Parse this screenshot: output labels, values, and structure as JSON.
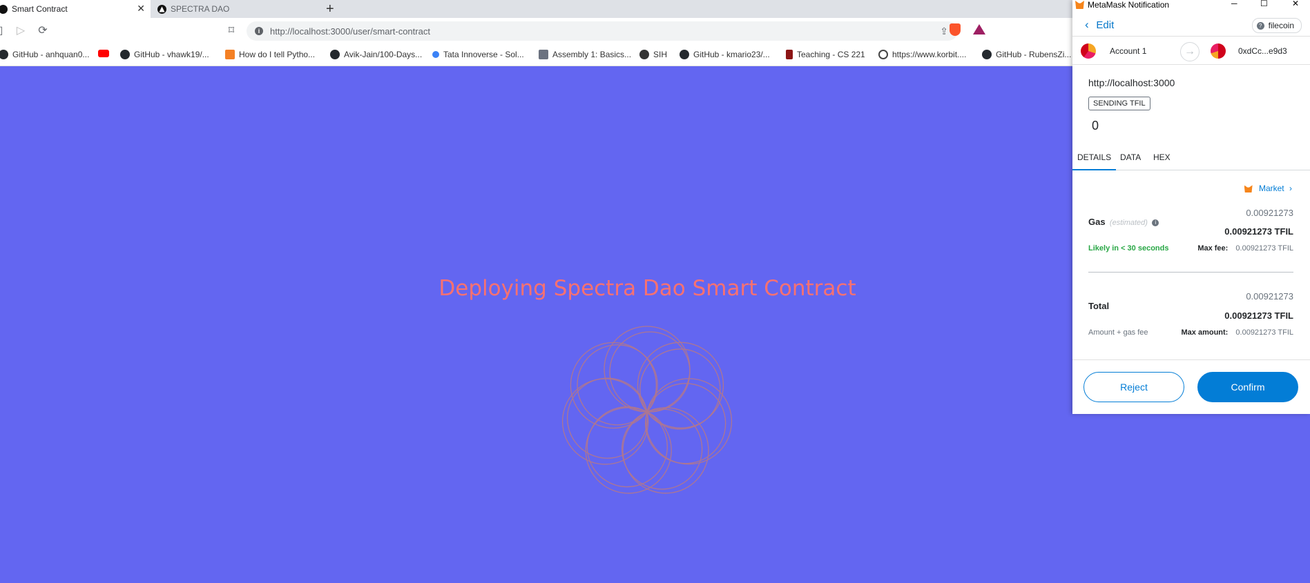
{
  "tabs": [
    {
      "title": "Smart Contract",
      "active": true
    },
    {
      "title": "SPECTRA DAO",
      "active": false
    }
  ],
  "address_bar": {
    "url": "http://localhost:3000/user/smart-contract"
  },
  "bookmarks": [
    {
      "label": "GitHub - anhquan0...",
      "icon": "github-icon"
    },
    {
      "label": "",
      "icon": "youtube-icon"
    },
    {
      "label": "GitHub - vhawk19/...",
      "icon": "github-icon"
    },
    {
      "label": "How do I tell Pytho...",
      "icon": "stackoverflow-icon"
    },
    {
      "label": "Avik-Jain/100-Days...",
      "icon": "github-icon"
    },
    {
      "label": "Tata Innoverse - Sol...",
      "icon": "tata-icon"
    },
    {
      "label": "Assembly 1: Basics...",
      "icon": "doc-icon"
    },
    {
      "label": "SIH",
      "icon": "globe-icon"
    },
    {
      "label": "GitHub - kmario23/...",
      "icon": "github-icon"
    },
    {
      "label": "Teaching - CS 221",
      "icon": "stanford-icon"
    },
    {
      "label": "https://www.korbit....",
      "icon": "korbit-icon"
    },
    {
      "label": "GitHub - RubensZi...",
      "icon": "github-icon"
    }
  ],
  "page": {
    "heading": "Deploying Spectra Dao Smart Contract",
    "colors": {
      "background": "#6366f1",
      "heading": "#f87171"
    }
  },
  "metamask": {
    "window_title": "MetaMask Notification",
    "back_label": "Edit",
    "network": "filecoin",
    "from_account": "Account 1",
    "to_account": "0xdCc...e9d3",
    "origin": "http://localhost:3000",
    "badge": "SENDING TFIL",
    "amount": "0",
    "tabs": [
      "DETAILS",
      "DATA",
      "HEX"
    ],
    "market_label": "Market",
    "gas": {
      "label": "Gas",
      "estimated": "(estimated)",
      "value": "0.00921273",
      "value_bold": "0.00921273 TFIL",
      "likely": "Likely in < 30 seconds",
      "max_fee_label": "Max fee:",
      "max_fee_value": "0.00921273 TFIL"
    },
    "total": {
      "label": "Total",
      "value": "0.00921273",
      "value_bold": "0.00921273 TFIL",
      "sub_label": "Amount + gas fee",
      "max_amount_label": "Max amount:",
      "max_amount_value": "0.00921273 TFIL"
    },
    "reject_label": "Reject",
    "confirm_label": "Confirm",
    "colors": {
      "primary": "#037dd6",
      "success": "#28a745"
    }
  }
}
